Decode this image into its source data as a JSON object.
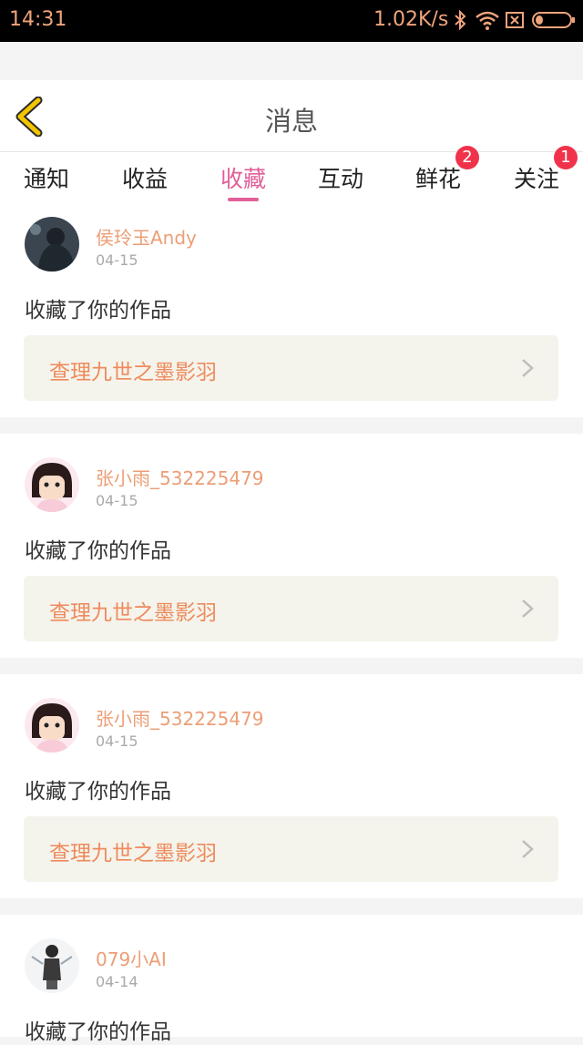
{
  "status_bar": {
    "time": "14:31",
    "network_speed": "1.02K/s",
    "icons": [
      "bluetooth-icon",
      "wifi-icon",
      "sim-card-icon",
      "battery-icon"
    ]
  },
  "header": {
    "title": "消息",
    "back_icon": "chevron-left-icon"
  },
  "tabs": [
    {
      "label": "通知",
      "active": false,
      "badge": ""
    },
    {
      "label": "收益",
      "active": false,
      "badge": ""
    },
    {
      "label": "收藏",
      "active": true,
      "badge": ""
    },
    {
      "label": "互动",
      "active": false,
      "badge": ""
    },
    {
      "label": "鲜花",
      "active": false,
      "badge": "2"
    },
    {
      "label": "关注",
      "active": false,
      "badge": "1"
    }
  ],
  "messages": [
    {
      "user": "侯玲玉Andy",
      "date": "04-15",
      "action": "收藏了你的作品",
      "work_title": "查理九世之墨影羽"
    },
    {
      "user": "张小雨_532225479",
      "date": "04-15",
      "action": "收藏了你的作品",
      "work_title": "查理九世之墨影羽"
    },
    {
      "user": "张小雨_532225479",
      "date": "04-15",
      "action": "收藏了你的作品",
      "work_title": "查理九世之墨影羽"
    },
    {
      "user": "079小AI",
      "date": "04-14",
      "action": "收藏了你的作品",
      "work_title": ""
    }
  ],
  "colors": {
    "accent": "#e25f99",
    "username": "#ec9e76",
    "work_title": "#ef8a5c",
    "badge": "#f0334b",
    "back_arrow": "#f2c500"
  }
}
